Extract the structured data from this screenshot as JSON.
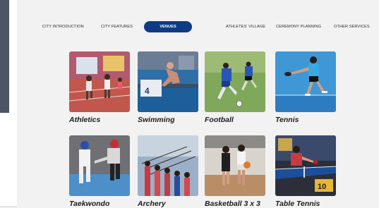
{
  "nav": {
    "items": [
      {
        "label": "CITY INTRODUCTION"
      },
      {
        "label": "CITY FEATURES"
      },
      {
        "label": "VENUES",
        "active": true
      },
      {
        "label": "ATHLETES' VILLAGE"
      },
      {
        "label": "CEREMONY PLANNING"
      },
      {
        "label": "OTHER SERVICES"
      }
    ]
  },
  "sports": [
    {
      "label": "Athletics",
      "icon": "athletics-photo"
    },
    {
      "label": "Swimming",
      "icon": "swimming-photo"
    },
    {
      "label": "Football",
      "icon": "football-photo"
    },
    {
      "label": "Tennis",
      "icon": "tennis-photo"
    },
    {
      "label": "Taekwondo",
      "icon": "taekwondo-photo"
    },
    {
      "label": "Archery",
      "icon": "archery-photo"
    },
    {
      "label": "Basketball 3 x 3",
      "icon": "basketball-photo"
    },
    {
      "label": "Table Tennis",
      "icon": "table-tennis-photo"
    }
  ],
  "colors": {
    "accent": "#0e3a86",
    "panel": "#f2f2f2"
  }
}
